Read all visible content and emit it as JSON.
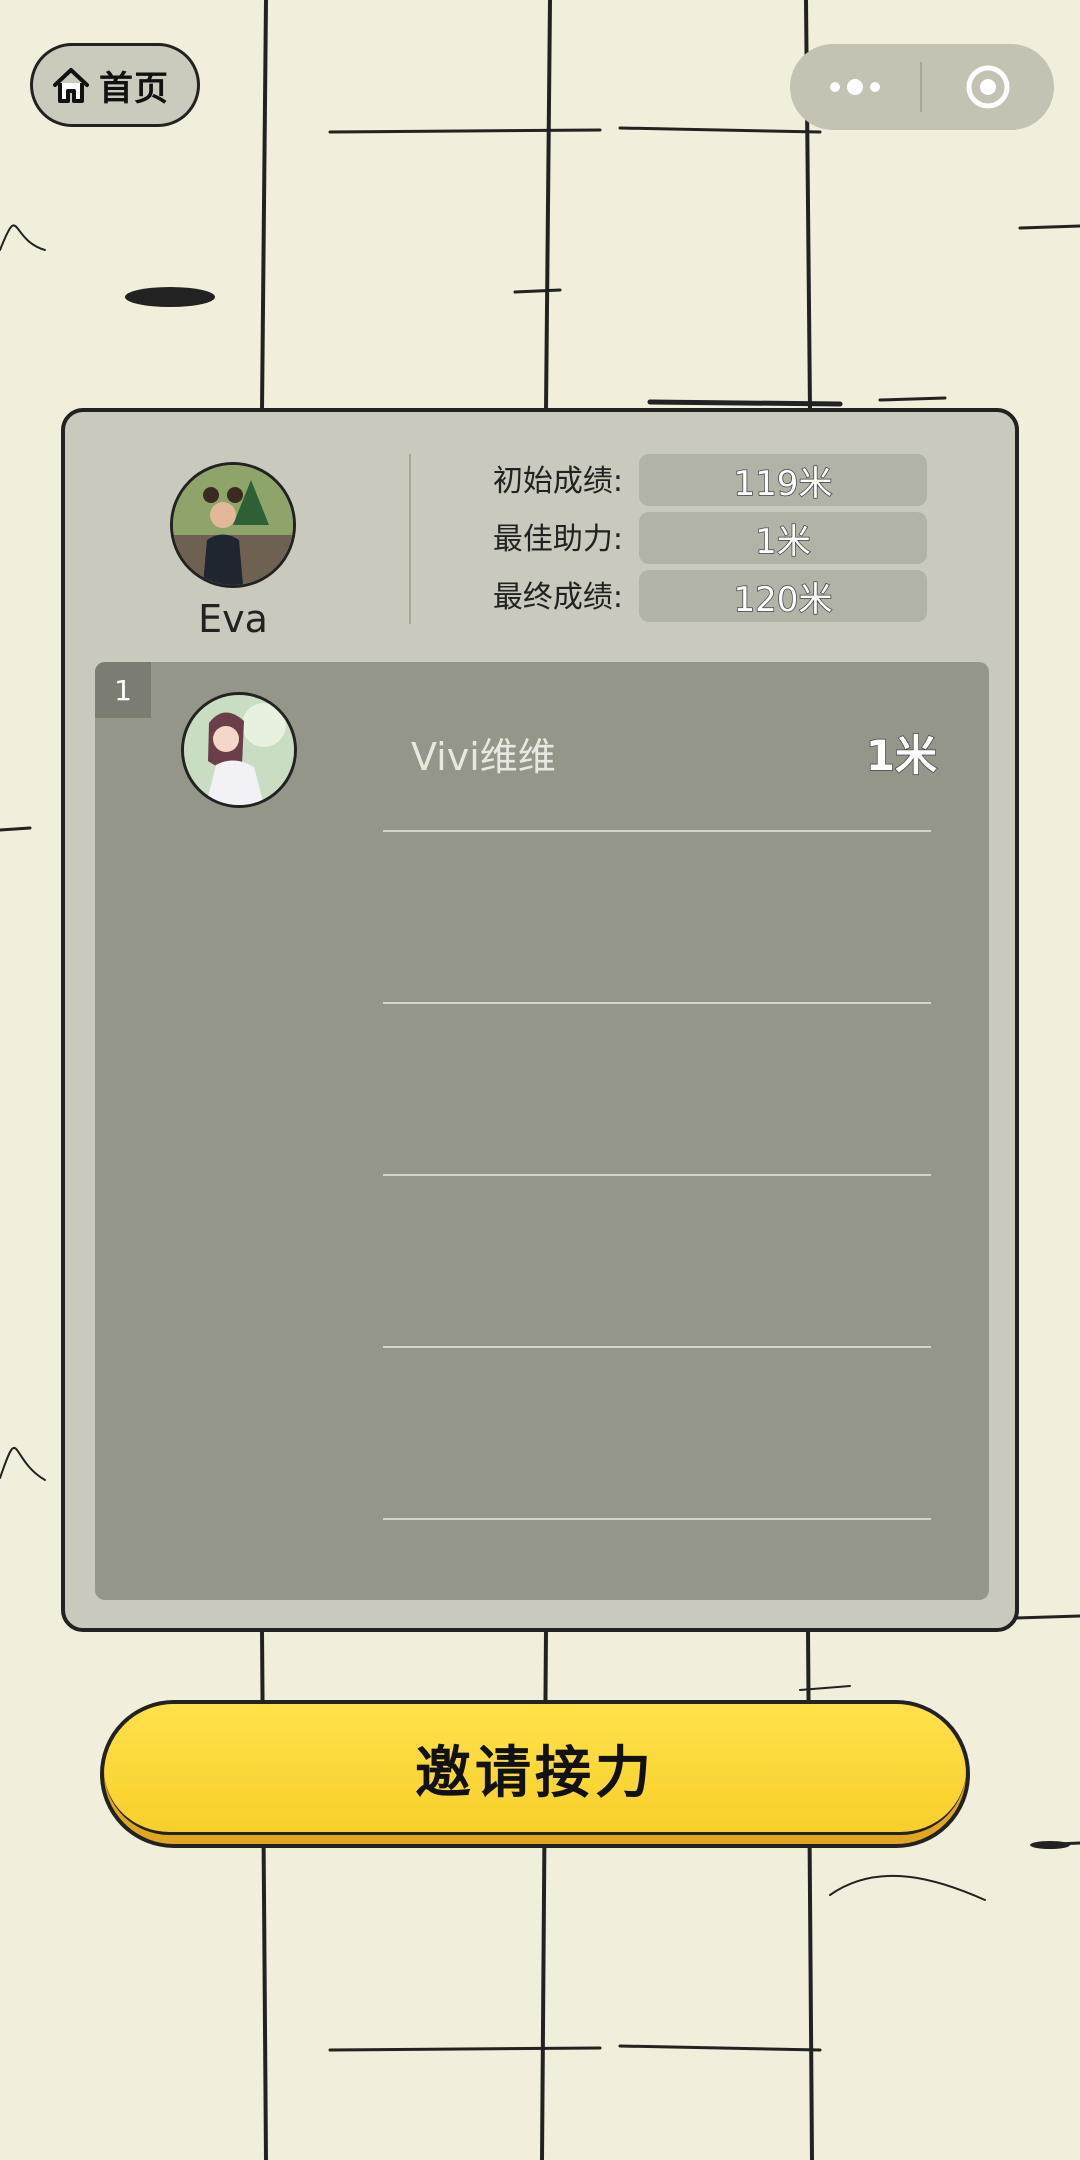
{
  "nav": {
    "home_label": "首页"
  },
  "profile": {
    "name": "Eva"
  },
  "stats": [
    {
      "label": "初始成绩:",
      "value": "119米"
    },
    {
      "label": "最佳助力:",
      "value": "1米"
    },
    {
      "label": "最终成绩:",
      "value": "120米"
    }
  ],
  "ranking": [
    {
      "rank": "1",
      "name": "Vivi维维",
      "score": "1米"
    }
  ],
  "actions": {
    "invite_label": "邀请接力"
  },
  "colors": {
    "background": "#f1eedc",
    "panel": "#c9cabd",
    "list": "#95968a",
    "button": "#ffe24a"
  },
  "icons": [
    "home-icon",
    "more-dots-icon",
    "target-icon"
  ]
}
